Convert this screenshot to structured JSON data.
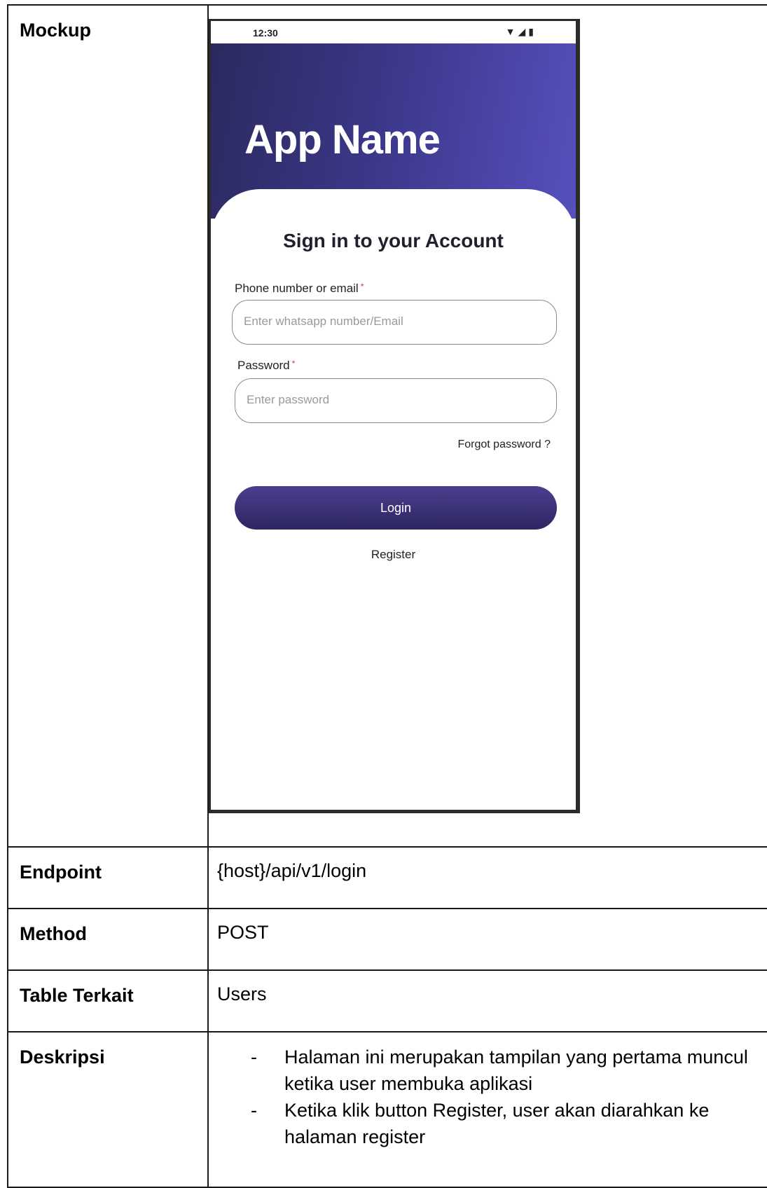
{
  "rows": {
    "mockup_label": "Mockup",
    "endpoint_label": "Endpoint",
    "endpoint_value": "{host}/api/v1/login",
    "method_label": "Method",
    "method_value": "POST",
    "table_label": "Table Terkait",
    "table_value": "Users",
    "desc_label": "Deskripsi",
    "desc_items": [
      "Halaman ini merupakan tampilan yang pertama muncul ketika user membuka aplikasi",
      "Ketika klik button Register, user akan diarahkan ke halaman register"
    ]
  },
  "mockup": {
    "status_time": "12:30",
    "status_icons": [
      "wifi-icon",
      "signal-icon",
      "battery-icon"
    ],
    "app_name": "App Name",
    "title": "Sign in to your Account",
    "phone_label": "Phone number or email",
    "phone_placeholder": "Enter whatsapp number/Email",
    "password_label": "Password",
    "password_placeholder": "Enter password",
    "required_mark": "*",
    "forgot": "Forgot password ?",
    "login": "Login",
    "register": "Register",
    "colors": {
      "header_start": "#2a2a5e",
      "header_end": "#5650bd",
      "button": "#2d2660"
    }
  }
}
